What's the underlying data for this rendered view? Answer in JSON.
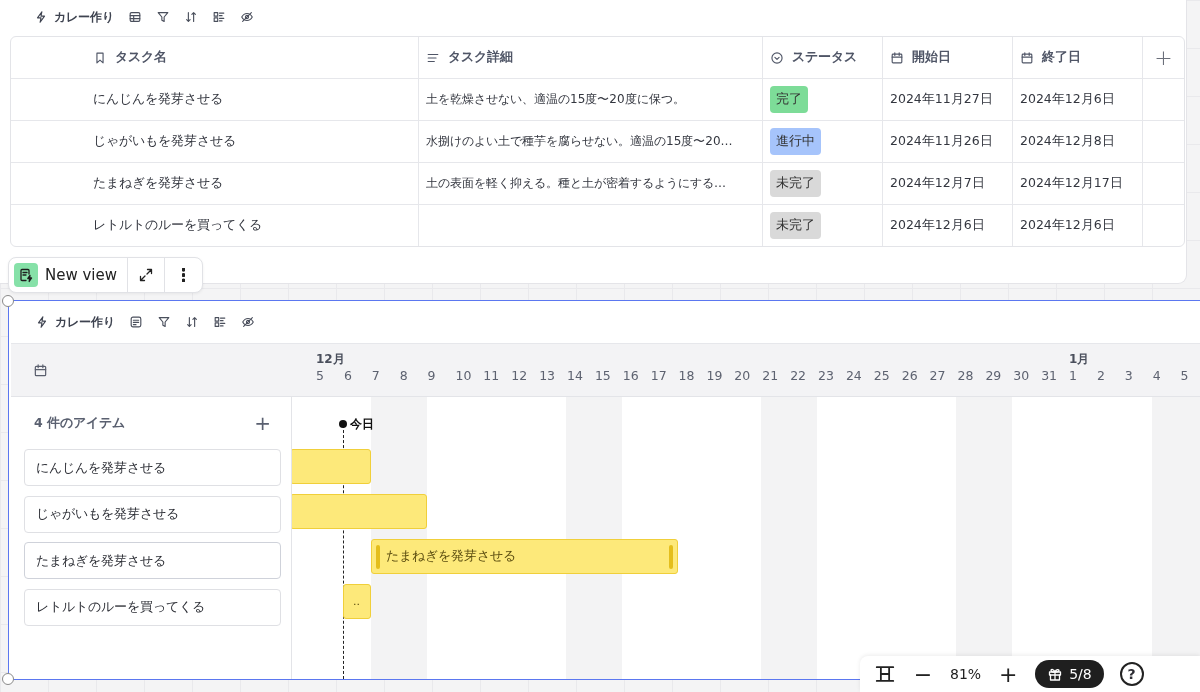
{
  "table_view": {
    "toolbar": {
      "title": "カレー作り"
    },
    "columns": [
      {
        "label": "タスク名",
        "kind": "title"
      },
      {
        "label": "タスク詳細",
        "kind": "text"
      },
      {
        "label": "ステータス",
        "kind": "status"
      },
      {
        "label": "開始日",
        "kind": "date"
      },
      {
        "label": "終了日",
        "kind": "date"
      }
    ],
    "add_column": "+",
    "rows": [
      {
        "name": "にんじんを発芽させる",
        "detail": "土を乾燥させない、適温の15度〜20度に保つ。",
        "status": {
          "label": "完了",
          "color": "#7ddc98"
        },
        "start": "2024年11月27日",
        "end": "2024年12月6日"
      },
      {
        "name": "じゃがいもを発芽させる",
        "detail": "水捌けのよい土で種芋を腐らせない。適温の15度〜20…",
        "status": {
          "label": "進行中",
          "color": "#a6c4fb"
        },
        "start": "2024年11月26日",
        "end": "2024年12月8日"
      },
      {
        "name": "たまねぎを発芽させる",
        "detail": "土の表面を軽く抑える。種と土が密着するようにする…",
        "status": {
          "label": "未完了",
          "color": "#d9d9d9"
        },
        "start": "2024年12月7日",
        "end": "2024年12月17日"
      },
      {
        "name": "レトルトのルーを買ってくる",
        "detail": "",
        "status": {
          "label": "未完了",
          "color": "#d9d9d9"
        },
        "start": "2024年12月6日",
        "end": "2024年12月6日"
      }
    ]
  },
  "view_tab": {
    "label": "New view"
  },
  "timeline_view": {
    "toolbar": {
      "title": "カレー作り"
    },
    "item_count": "4 件のアイテム",
    "add_item": "+",
    "today": {
      "label": "今日"
    },
    "days": [
      {
        "label": "5",
        "month": "12月",
        "weekend": false,
        "today": false
      },
      {
        "label": "6",
        "weekend": false,
        "today": true
      },
      {
        "label": "7",
        "weekend": true,
        "today": false
      },
      {
        "label": "8",
        "weekend": true,
        "today": false
      },
      {
        "label": "9",
        "weekend": false,
        "today": false
      },
      {
        "label": "10",
        "weekend": false,
        "today": false
      },
      {
        "label": "11",
        "weekend": false,
        "today": false
      },
      {
        "label": "12",
        "weekend": false,
        "today": false
      },
      {
        "label": "13",
        "weekend": false,
        "today": false
      },
      {
        "label": "14",
        "weekend": true,
        "today": false
      },
      {
        "label": "15",
        "weekend": true,
        "today": false
      },
      {
        "label": "16",
        "weekend": false,
        "today": false
      },
      {
        "label": "17",
        "weekend": false,
        "today": false
      },
      {
        "label": "18",
        "weekend": false,
        "today": false
      },
      {
        "label": "19",
        "weekend": false,
        "today": false
      },
      {
        "label": "20",
        "weekend": false,
        "today": false
      },
      {
        "label": "21",
        "weekend": true,
        "today": false
      },
      {
        "label": "22",
        "weekend": true,
        "today": false
      },
      {
        "label": "23",
        "weekend": false,
        "today": false
      },
      {
        "label": "24",
        "weekend": false,
        "today": false
      },
      {
        "label": "25",
        "weekend": false,
        "today": false
      },
      {
        "label": "26",
        "weekend": false,
        "today": false
      },
      {
        "label": "27",
        "weekend": false,
        "today": false
      },
      {
        "label": "28",
        "weekend": true,
        "today": false
      },
      {
        "label": "29",
        "weekend": true,
        "today": false
      },
      {
        "label": "30",
        "weekend": false,
        "today": false
      },
      {
        "label": "31",
        "weekend": false,
        "today": false
      },
      {
        "label": "1",
        "month": "1月",
        "weekend": false,
        "today": false
      },
      {
        "label": "2",
        "weekend": false,
        "today": false
      },
      {
        "label": "3",
        "weekend": false,
        "today": false
      },
      {
        "label": "4",
        "weekend": true,
        "today": false
      },
      {
        "label": "5",
        "weekend": true,
        "today": false
      }
    ],
    "items": [
      {
        "name": "にんじんを発芽させる",
        "selected": false
      },
      {
        "name": "じゃがいもを発芽させる",
        "selected": false
      },
      {
        "name": "たまねぎを発芽させる",
        "bar_label": "たまねぎを発芽させる",
        "selected": true
      },
      {
        "name": "レトルトのルーを買ってくる",
        "bar_label": "..",
        "selected": false
      }
    ]
  },
  "zoom_bar": {
    "zoom": "81%",
    "minus": "−",
    "plus": "+",
    "gifts": "5/8",
    "help": "?"
  }
}
